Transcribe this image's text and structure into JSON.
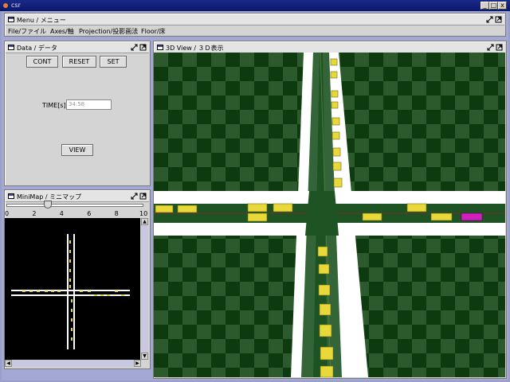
{
  "window": {
    "title": "csr",
    "minimize_glyph": "_",
    "maximize_glyph": "□",
    "close_glyph": "x"
  },
  "menu_frame": {
    "title": "Menu / メニュー",
    "items": [
      {
        "label": "File/ファイル"
      },
      {
        "label": "Axes/軸"
      },
      {
        "label": "Projection/投影画法"
      },
      {
        "label": "Floor/床"
      }
    ]
  },
  "data_frame": {
    "title": "Data / データ",
    "cont_label": "CONT",
    "reset_label": "RESET",
    "set_label": "SET",
    "time_label": "TIME[s]",
    "time_value": "34.58",
    "view_label": "VIEW"
  },
  "minimap_frame": {
    "title": "MiniMap / ミニマップ",
    "slider": {
      "min": 0,
      "max": 10,
      "value": 3
    },
    "ticks": [
      "0",
      "2",
      "4",
      "6",
      "8",
      "10"
    ]
  },
  "view3d_frame": {
    "title": "3D View / ３Ｄ表示"
  },
  "icons": {
    "frame": "frame-icon",
    "restore": "restore-icon",
    "maximize": "maximize-icon"
  },
  "colors": {
    "desktop": "#a4a8d4",
    "titlebar": "#0a176a",
    "road": "#ffffff",
    "grass_dark": "#0e3a10",
    "grass_light": "#2c5a2c",
    "car": "#e8d83a",
    "car_highlight": "#d020c0"
  }
}
